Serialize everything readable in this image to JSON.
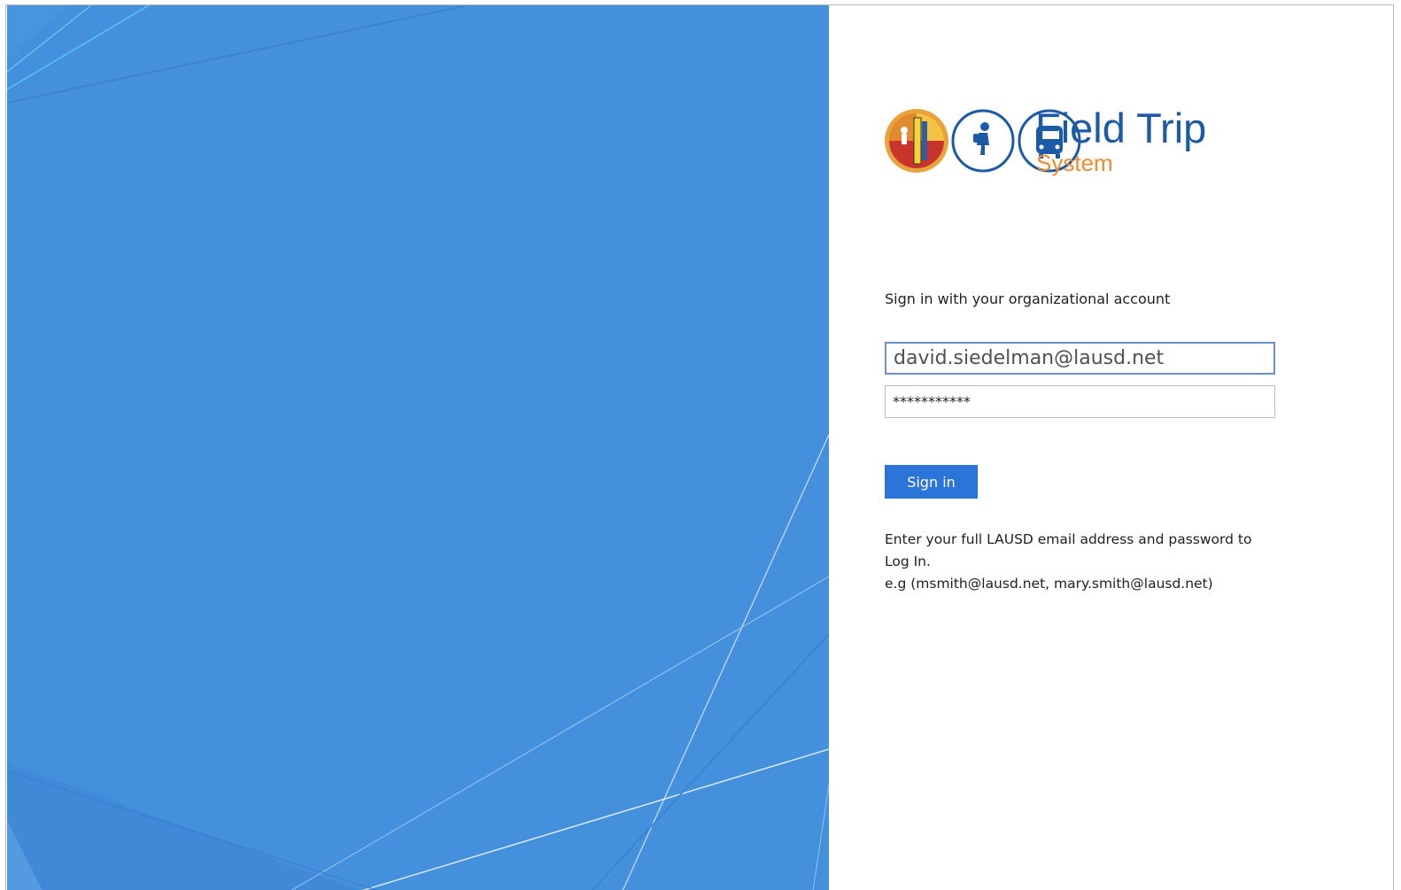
{
  "colors": {
    "background_blue": "#4590dc",
    "brand_blue": "#1b5aa6",
    "brand_orange": "#f28a30",
    "button_blue": "#2d74d9"
  },
  "logo": {
    "title": "Field Trip",
    "subtitle": "System",
    "icons": [
      "lausd-seal-icon",
      "walking-student-icon",
      "bus-icon"
    ]
  },
  "login": {
    "heading": "Sign in with your organizational account",
    "email_value": "david.siedelman@lausd.net",
    "password_value": "***********",
    "signin_label": "Sign in",
    "help_line1": "Enter your full LAUSD email address and password to",
    "help_line2": "Log In.",
    "help_line3": "e.g (msmith@lausd.net, mary.smith@lausd.net)"
  }
}
